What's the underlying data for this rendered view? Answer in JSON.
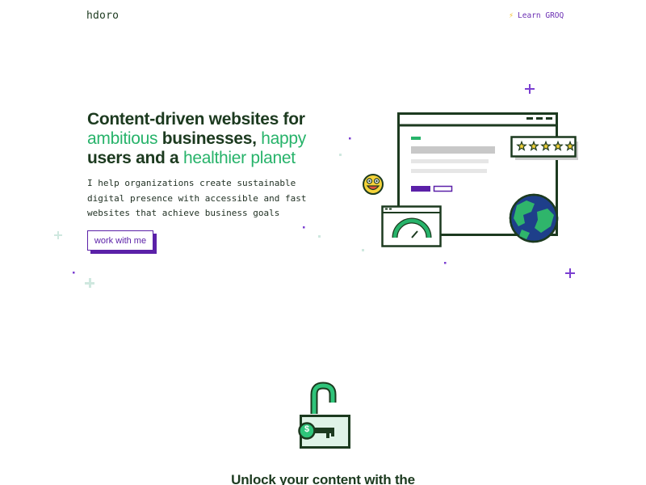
{
  "header": {
    "logo": "hdoro",
    "learn_link": "Learn GROQ",
    "learn_icon": "lightning-bolt-icon"
  },
  "hero": {
    "title_parts": [
      "Content-driven websites for ",
      "ambitious",
      " businesses, ",
      "happy",
      " users and a ",
      "healthier planet"
    ],
    "description": "I help organizations create sustainable digital presence with accessible and fast websites that achieve business goals",
    "cta_label": "work with me"
  },
  "illustration": {
    "rating_stars": 5,
    "gauge_level": 0.7,
    "icons": [
      "smiley-face-icon",
      "star-icon",
      "gauge-icon",
      "globe-icon",
      "sparkle-icon"
    ]
  },
  "section": {
    "lock_icon": "unlocked-padlock-icon",
    "lock_symbol": "$",
    "title": "Unlock your content with the"
  },
  "colors": {
    "dark_green": "#1c3a1f",
    "accent_green": "#27b36a",
    "purple": "#5b21a8"
  }
}
